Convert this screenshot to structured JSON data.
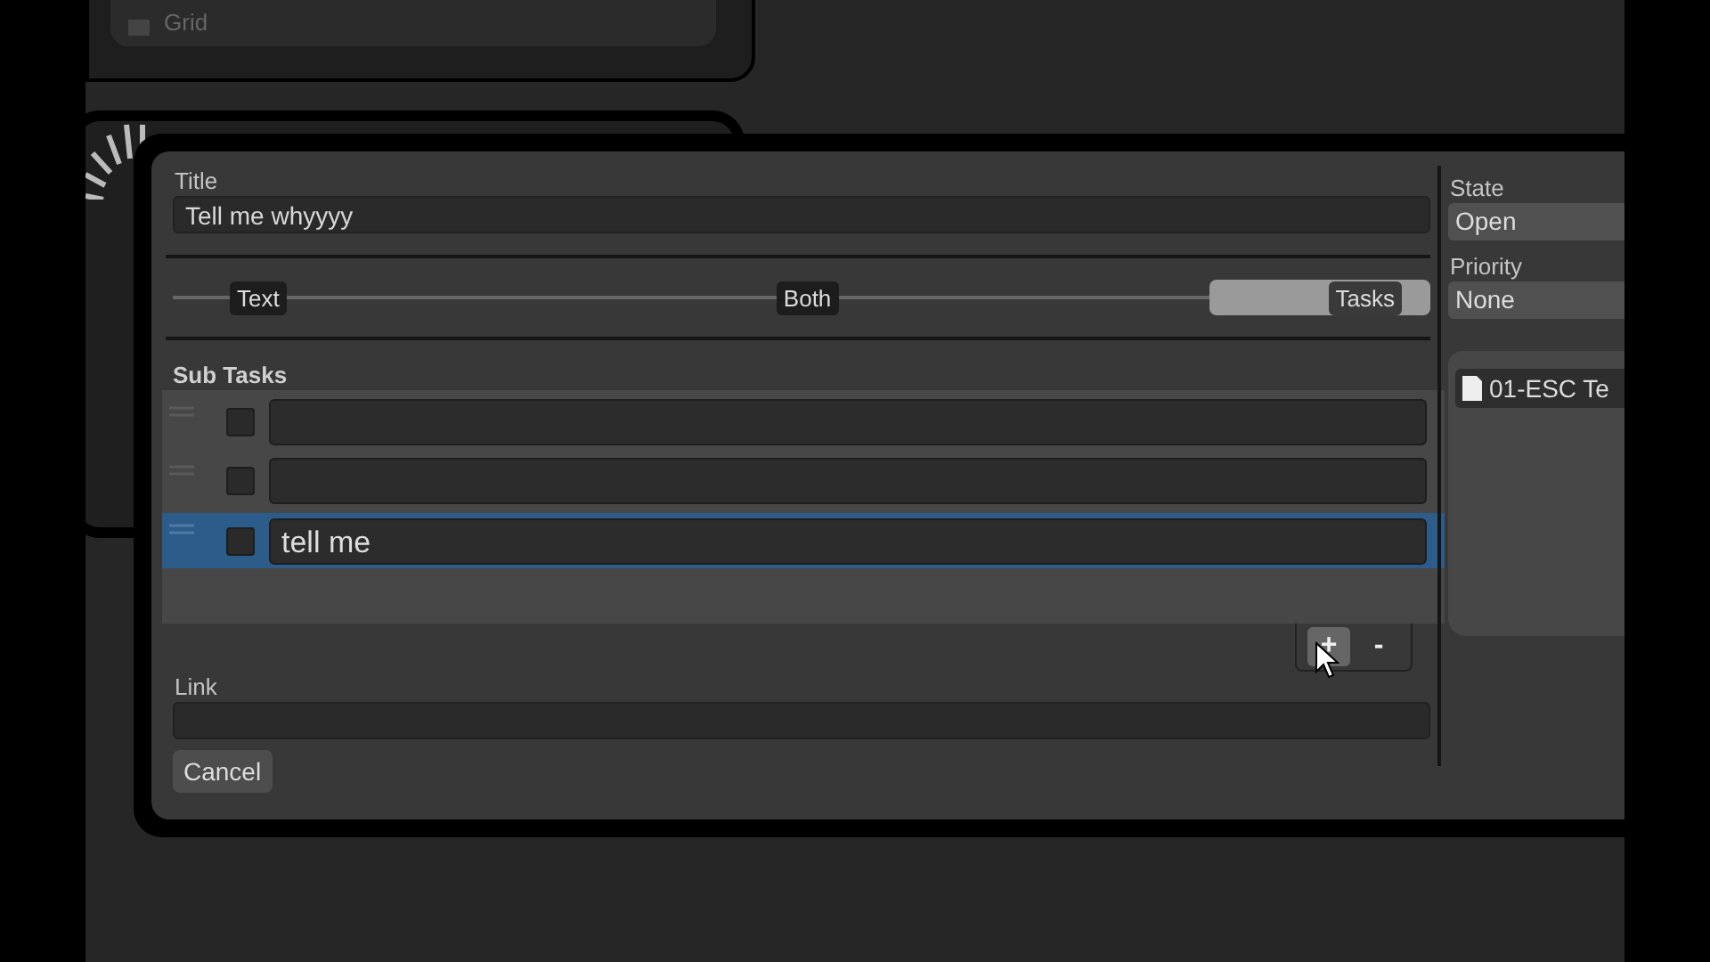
{
  "background_card": {
    "label": "Grid"
  },
  "dialog": {
    "title_field": {
      "label": "Title",
      "value": "Tell me whyyyy"
    },
    "view_mode": {
      "options": [
        {
          "label": "Text",
          "selected": false
        },
        {
          "label": "Both",
          "selected": false
        },
        {
          "label": "Tasks",
          "selected": true
        }
      ]
    },
    "sub_tasks": {
      "label": "Sub Tasks",
      "rows": [
        {
          "checked": false,
          "selected": false
        },
        {
          "checked": false,
          "selected": false
        },
        {
          "value": "tell me",
          "checked": false,
          "selected": true
        }
      ],
      "buttons": [
        "+",
        "-"
      ]
    },
    "link_field": {
      "label": "Link"
    },
    "cancel_button": "Cancel",
    "state_field": {
      "label": "State",
      "value": "Open"
    },
    "priority_field": {
      "label": "Priority",
      "value": "None"
    },
    "attachments": [
      {
        "name": "01-ESC Te"
      }
    ]
  }
}
